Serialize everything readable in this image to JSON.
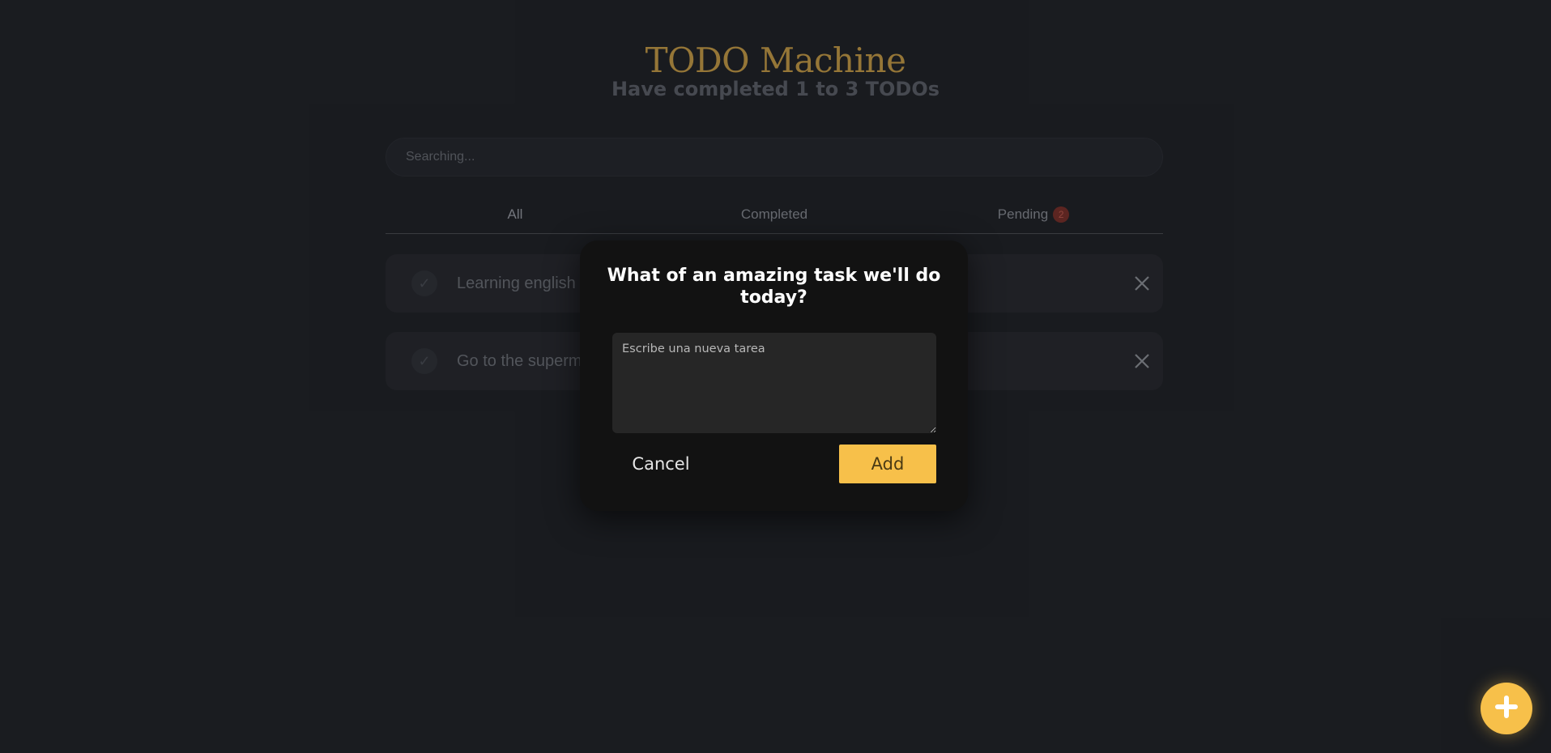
{
  "app": {
    "title": "TODO Machine",
    "counter": "Have completed 1 to 3 TODOs"
  },
  "search": {
    "placeholder": "Searching..."
  },
  "tabs": [
    {
      "label": "All"
    },
    {
      "label": "Completed"
    },
    {
      "label": "Pending",
      "badge": "2"
    }
  ],
  "todos": [
    {
      "text": "Learning english"
    },
    {
      "text": "Go to the superm"
    }
  ],
  "modal": {
    "title": "What of an amazing task we'll do today?",
    "textarea_placeholder": "Escribe una nueva tarea",
    "cancel_label": "Cancel",
    "add_label": "Add"
  },
  "icons": {
    "check": "check-icon",
    "delete": "close-icon",
    "fab": "plus-icon"
  },
  "colors": {
    "background": "#1e2025",
    "accent": "#f7c04a",
    "title": "#c99e46",
    "modal": "#121212",
    "badge": "#7a2f27"
  }
}
